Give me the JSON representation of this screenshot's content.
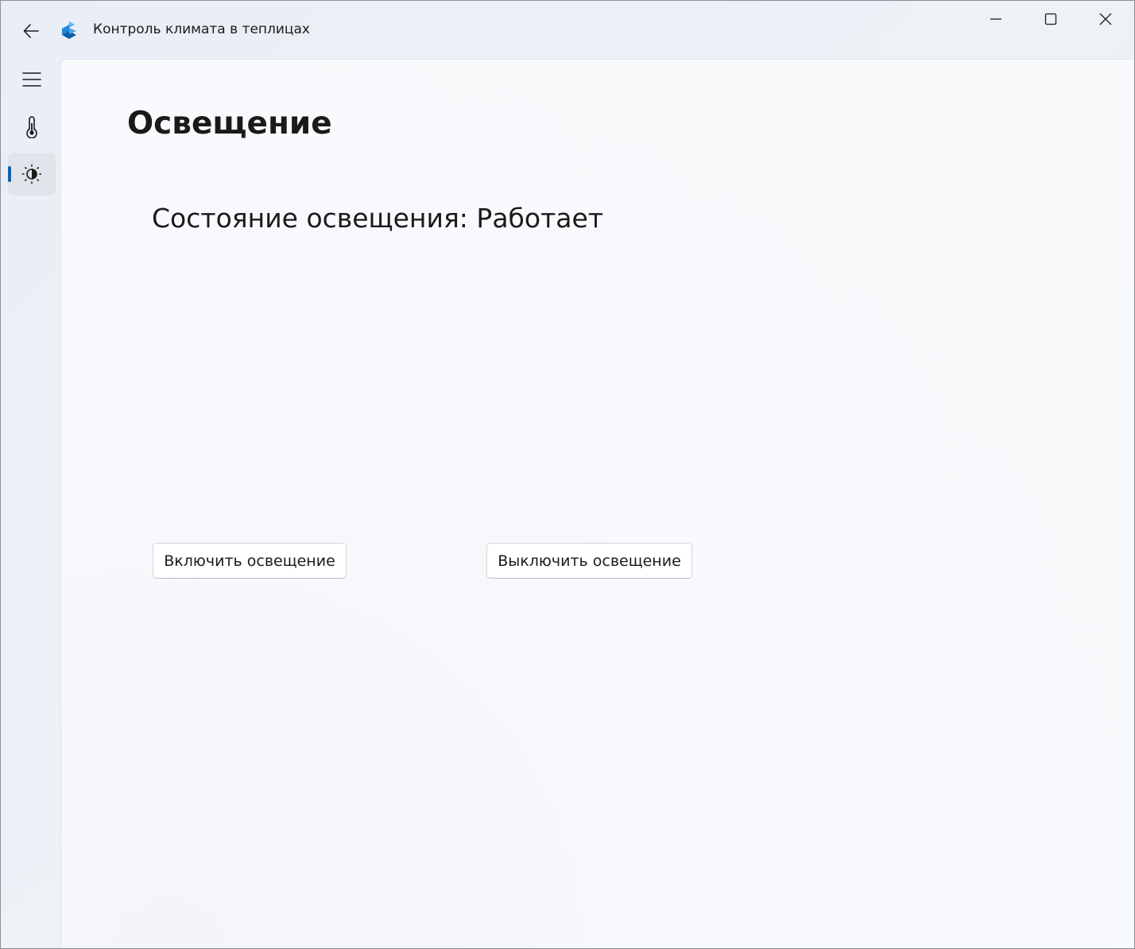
{
  "window": {
    "title": "Контроль климата в теплицах"
  },
  "nav": {
    "items": [
      {
        "name": "menu",
        "icon": "hamburger-icon"
      },
      {
        "name": "climate",
        "icon": "thermometer-icon"
      },
      {
        "name": "lighting",
        "icon": "brightness-icon",
        "selected": true
      }
    ]
  },
  "page": {
    "title": "Освещение",
    "status_label": "Состояние освещения:",
    "status_value": "Работает"
  },
  "buttons": {
    "turn_on": "Включить освещение",
    "turn_off": "Выключить освещение"
  },
  "colors": {
    "accent": "#0067c0",
    "logo_primary": "#1e88d6"
  }
}
